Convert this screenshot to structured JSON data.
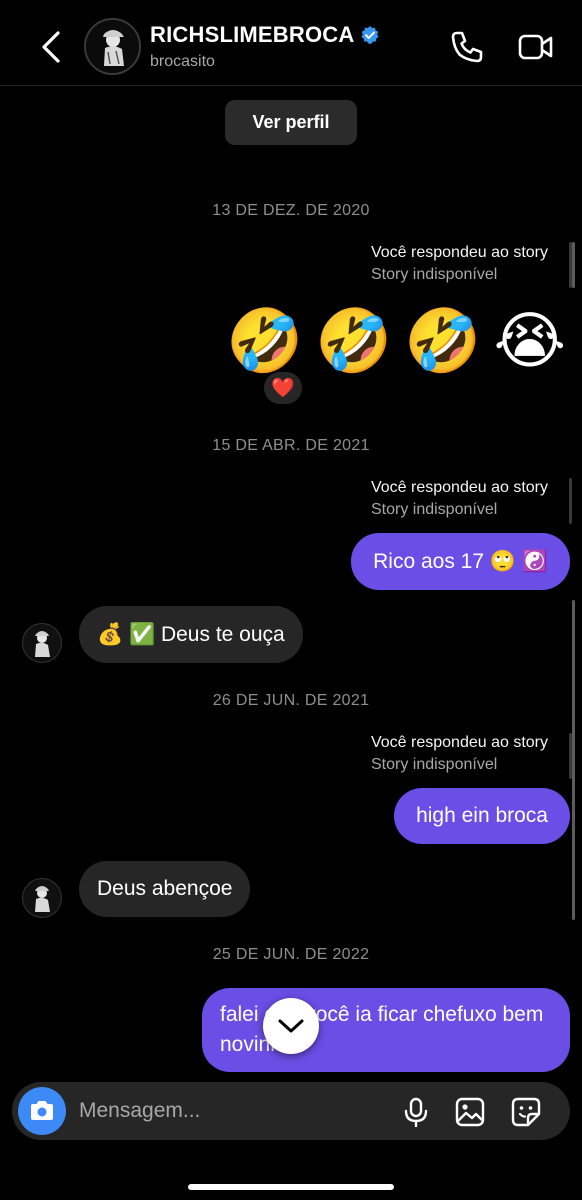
{
  "header": {
    "display_name": "RICHSLIMEBROCA",
    "username": "brocasito",
    "verified": true
  },
  "profile_button": "Ver perfil",
  "conversation": {
    "dates": [
      "13 DE DEZ. DE 2020",
      "15 DE ABR. DE 2021",
      "26 DE JUN. DE 2021",
      "25 DE JUN. DE 2022"
    ],
    "story_reply": {
      "title": "Você respondeu ao story",
      "subtitle": "Story indisponível"
    },
    "emoji_message": [
      "🤣",
      "🤣",
      "🤣",
      "😭"
    ],
    "reaction": "❤️",
    "messages": [
      {
        "from": "me",
        "text": "Rico aos 17 🙄 ☯️"
      },
      {
        "from": "them",
        "text": "💰 ✅ Deus te ouça"
      },
      {
        "from": "me",
        "text": "high ein broca"
      },
      {
        "from": "them",
        "text": "Deus abençoe"
      },
      {
        "from": "me",
        "text": "falei que você ia ficar chefuxo bem novinho"
      }
    ]
  },
  "composer": {
    "placeholder": "Mensagem..."
  },
  "colors": {
    "outgoing_bubble": "#6b4ee6",
    "incoming_bubble": "#262626",
    "accent": "#3d8af7"
  }
}
